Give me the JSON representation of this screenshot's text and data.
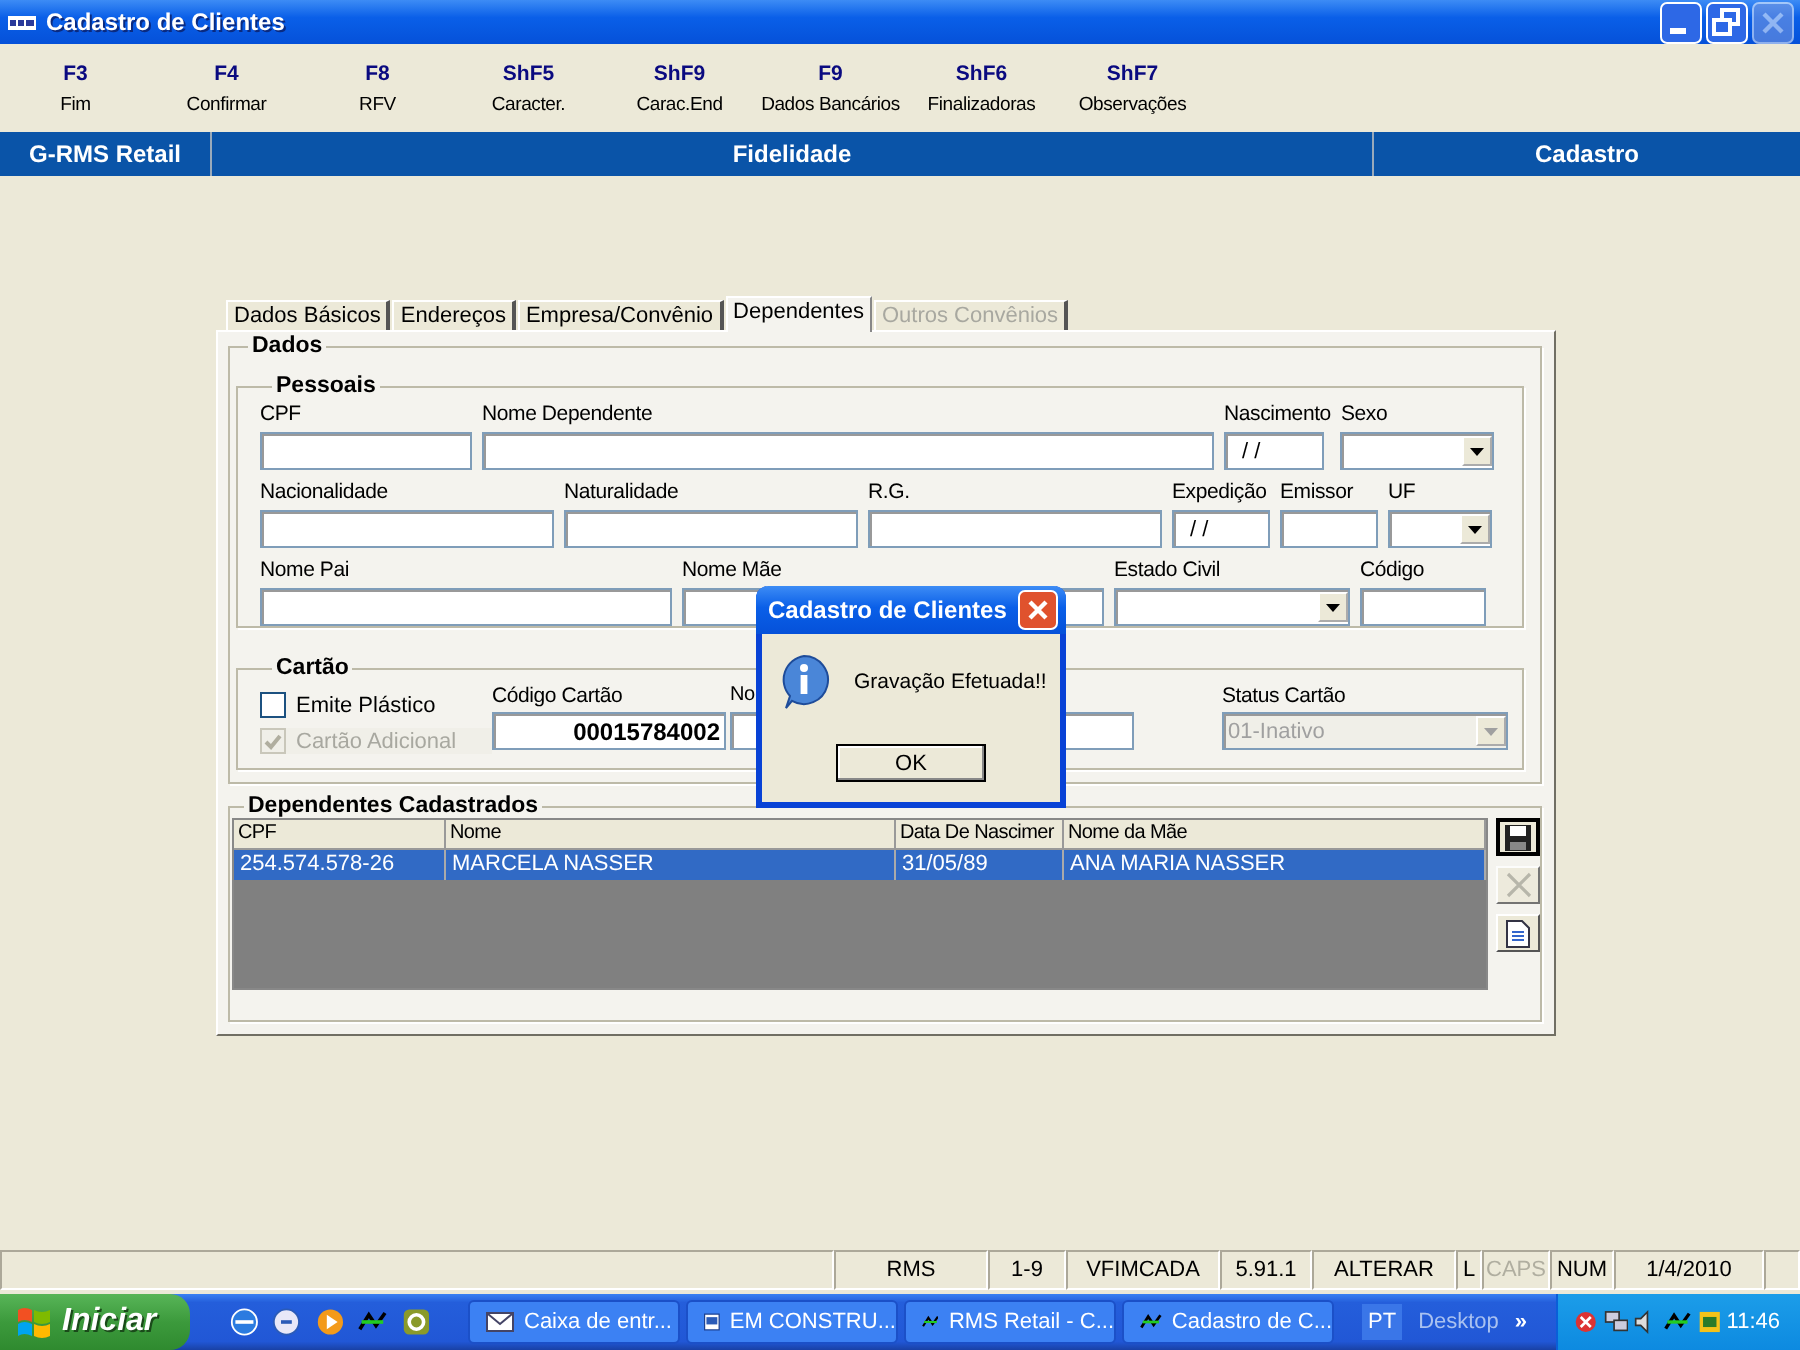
{
  "window": {
    "title": "Cadastro de Clientes"
  },
  "function_keys": [
    {
      "key": "F3",
      "label": "Fim"
    },
    {
      "key": "F4",
      "label": "Confirmar"
    },
    {
      "key": "F8",
      "label": "RFV"
    },
    {
      "key": "ShF5",
      "label": "Caracter."
    },
    {
      "key": "ShF9",
      "label": "Carac.End"
    },
    {
      "key": "F9",
      "label": "Dados Bancários"
    },
    {
      "key": "ShF6",
      "label": "Finalizadoras"
    },
    {
      "key": "ShF7",
      "label": "Observações"
    }
  ],
  "header": [
    "G-RMS Retail",
    "Fidelidade",
    "Cadastro"
  ],
  "tabs": [
    {
      "label": "Dados Básicos",
      "selected": false,
      "disabled": false
    },
    {
      "label": "Endereços",
      "selected": false,
      "disabled": false
    },
    {
      "label": "Empresa/Convênio",
      "selected": false,
      "disabled": false
    },
    {
      "label": "Dependentes",
      "selected": true,
      "disabled": false
    },
    {
      "label": "Outros Convênios",
      "selected": false,
      "disabled": true
    }
  ],
  "dados": {
    "title": "Dados",
    "pessoais": {
      "title": "Pessoais",
      "fields": [
        {
          "label": "CPF",
          "kind": "text"
        },
        {
          "label": "Nome Dependente",
          "kind": "text"
        },
        {
          "label": "Nascimento",
          "kind": "date",
          "value": "/ /"
        },
        {
          "label": "Sexo",
          "kind": "select"
        },
        {
          "label": "Nacionalidade",
          "kind": "text"
        },
        {
          "label": "Naturalidade",
          "kind": "text"
        },
        {
          "label": "R.G.",
          "kind": "text"
        },
        {
          "label": "Expedição",
          "kind": "date",
          "value": "/ /"
        },
        {
          "label": "Emissor",
          "kind": "text"
        },
        {
          "label": "UF",
          "kind": "select"
        },
        {
          "label": "Nome Pai",
          "kind": "text"
        },
        {
          "label": "Nome Mãe",
          "kind": "text"
        },
        {
          "label": "Estado Civil",
          "kind": "select"
        },
        {
          "label": "Código",
          "kind": "text"
        }
      ]
    }
  },
  "cartao": {
    "title": "Cartão",
    "checkboxes": [
      {
        "label": "Emite Plástico",
        "checked": false,
        "disabled": false
      },
      {
        "label": "Cartão Adicional",
        "checked": true,
        "disabled": true
      }
    ],
    "fields": [
      {
        "label": "Código Cartão",
        "kind": "text",
        "value": "00015784002",
        "disabled": false
      },
      {
        "label": "No",
        "kind": "text",
        "disabled": false
      },
      {
        "label": "Status Cartão",
        "kind": "select",
        "value": "01-Inativo",
        "disabled": true
      }
    ]
  },
  "dependentes": {
    "title": "Dependentes Cadastrados",
    "columns": [
      "CPF",
      "Nome",
      "Data De Nascimer",
      "Nome da Mãe"
    ],
    "rows": [
      {
        "cells": [
          "254.574.578-26",
          "MARCELA NASSER",
          "31/05/89",
          "ANA MARIA NASSER"
        ],
        "selected": true
      }
    ],
    "actions": [
      {
        "kind": "save",
        "disabled": false
      },
      {
        "kind": "delete",
        "disabled": true
      },
      {
        "kind": "new",
        "disabled": false
      }
    ]
  },
  "dialog": {
    "title": "Cadastro de Clientes",
    "message": "Gravação Efetuada!!",
    "button": "OK"
  },
  "status_bar": [
    {
      "text": "RMS",
      "active": true
    },
    {
      "text": "1-9",
      "active": true
    },
    {
      "text": "VFIMCADA",
      "active": true
    },
    {
      "text": "5.91.1",
      "active": true
    },
    {
      "text": "ALTERAR",
      "active": true
    },
    {
      "text": "L",
      "active": true
    },
    {
      "text": "CAPS",
      "active": false
    },
    {
      "text": "NUM",
      "active": true
    },
    {
      "text": "1/4/2010",
      "active": true
    }
  ],
  "taskbar": {
    "start": "Iniciar",
    "tasks": [
      {
        "label": "Caixa de entr...",
        "kind": "mail",
        "selected": false
      },
      {
        "label": "EM CONSTRU...",
        "kind": "document",
        "selected": false
      },
      {
        "label": "RMS Retail - C...",
        "kind": "app",
        "selected": false
      },
      {
        "label": "Cadastro de C...",
        "kind": "app",
        "selected": false
      }
    ],
    "language": "PT",
    "toolbar": "Desktop",
    "chevron": "»",
    "clock": "11:46"
  }
}
